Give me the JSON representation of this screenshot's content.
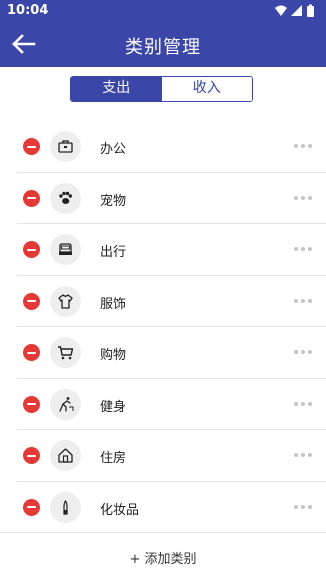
{
  "status": {
    "time": "10:04"
  },
  "header": {
    "title": "类别管理"
  },
  "tabs": [
    {
      "label": "支出"
    },
    {
      "label": "收入"
    }
  ],
  "categories": [
    {
      "label": "办公",
      "icon": "briefcase-icon"
    },
    {
      "label": "宠物",
      "icon": "paw-icon"
    },
    {
      "label": "出行",
      "icon": "car-icon"
    },
    {
      "label": "服饰",
      "icon": "shirt-icon"
    },
    {
      "label": "购物",
      "icon": "cart-icon"
    },
    {
      "label": "健身",
      "icon": "fitness-icon"
    },
    {
      "label": "住房",
      "icon": "house-icon"
    },
    {
      "label": "化妆品",
      "icon": "cosmetics-icon"
    }
  ],
  "footer": {
    "add_label": "+ 添加类别"
  },
  "colors": {
    "primary": "#3b47a8",
    "delete": "#e53935"
  }
}
